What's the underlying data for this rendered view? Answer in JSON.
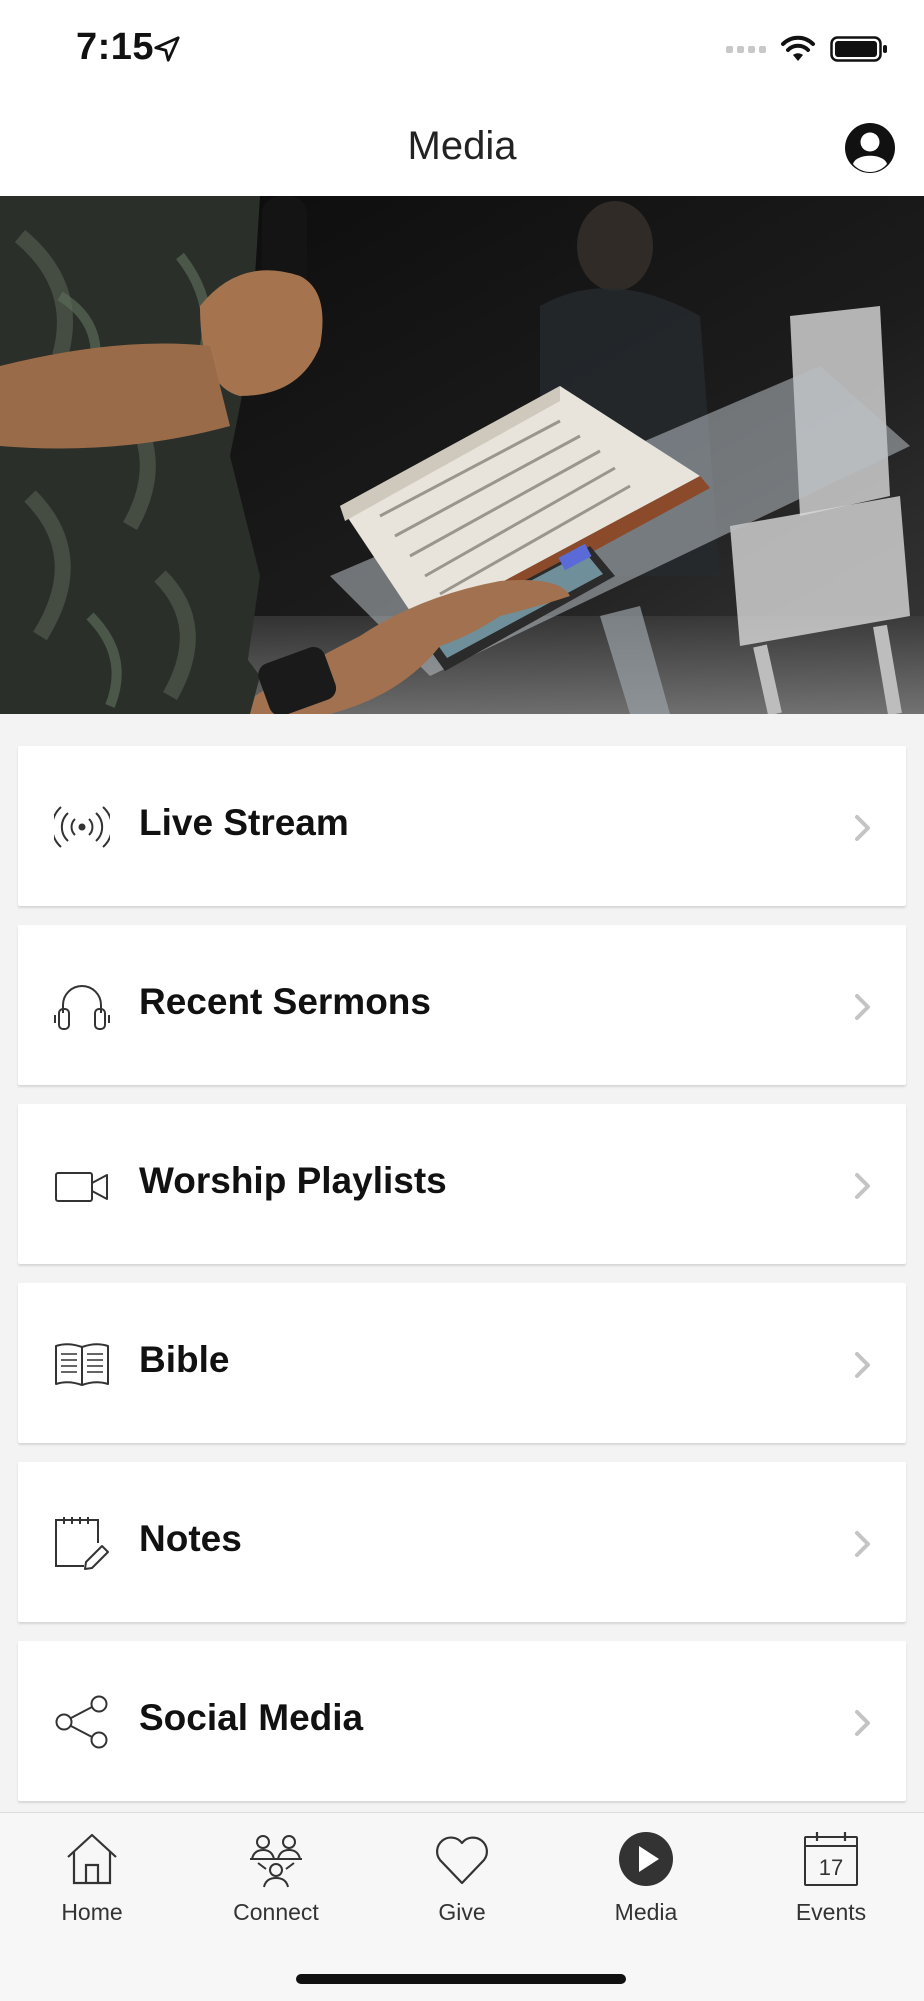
{
  "status": {
    "time": "7:15"
  },
  "header": {
    "title": "Media"
  },
  "menu": [
    {
      "label": "Live Stream",
      "icon": "live-stream-icon"
    },
    {
      "label": "Recent Sermons",
      "icon": "headphones-icon"
    },
    {
      "label": "Worship Playlists",
      "icon": "video-camera-icon"
    },
    {
      "label": "Bible",
      "icon": "book-icon"
    },
    {
      "label": "Notes",
      "icon": "notepad-pencil-icon"
    },
    {
      "label": "Social Media",
      "icon": "share-icon"
    }
  ],
  "tabs": [
    {
      "label": "Home",
      "icon": "home-icon"
    },
    {
      "label": "Connect",
      "icon": "people-icon"
    },
    {
      "label": "Give",
      "icon": "heart-icon"
    },
    {
      "label": "Media",
      "icon": "play-circle-icon",
      "active": true
    },
    {
      "label": "Events",
      "icon": "calendar-icon",
      "calendar_day": "17"
    }
  ],
  "colors": {
    "accent": "#333333",
    "background": "#f3f3f3",
    "card": "#ffffff"
  }
}
